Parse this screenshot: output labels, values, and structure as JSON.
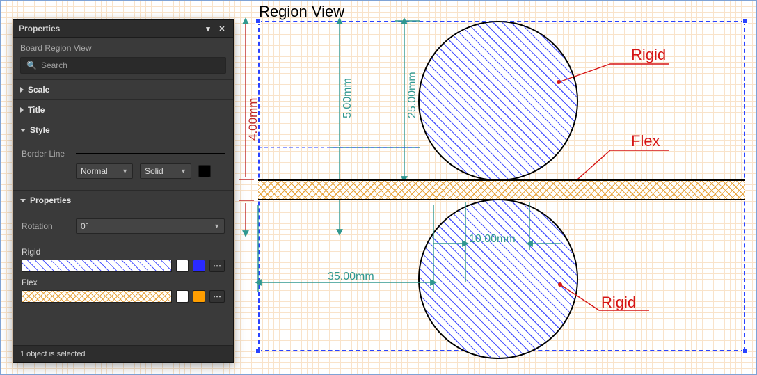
{
  "panel": {
    "title": "Properties",
    "subtitle": "Board Region View",
    "search_placeholder": "Search",
    "sections": {
      "scale": {
        "label": "Scale",
        "expanded": false
      },
      "title": {
        "label": "Title",
        "expanded": false
      },
      "style": {
        "label": "Style",
        "expanded": true,
        "border_label": "Border Line",
        "line_style": {
          "weight": "Normal",
          "pattern": "Solid",
          "color": "#000000"
        }
      },
      "props": {
        "label": "Properties",
        "expanded": true,
        "rotation_label": "Rotation",
        "rotation_value": "0°",
        "regions": [
          {
            "name": "Rigid",
            "pattern": "blue-hatch",
            "swatch": "#2a2aff"
          },
          {
            "name": "Flex",
            "pattern": "orange-crosshatch",
            "swatch": "#ff9e00"
          }
        ]
      }
    },
    "status": "1 object is selected"
  },
  "view": {
    "title": "Region View",
    "labels": {
      "rigid_top": "Rigid",
      "flex": "Flex",
      "rigid_bottom": "Rigid"
    },
    "dimensions": {
      "d_25": "25.00mm",
      "d_5": "5.00mm",
      "d_4": "4.00mm",
      "d_35": "35.00mm",
      "d_10": "10.00mm"
    }
  },
  "colors": {
    "accent_blue": "#2a42ff",
    "dim_cyan": "#309890",
    "dim_red": "#c02828",
    "red": "#d61515"
  }
}
